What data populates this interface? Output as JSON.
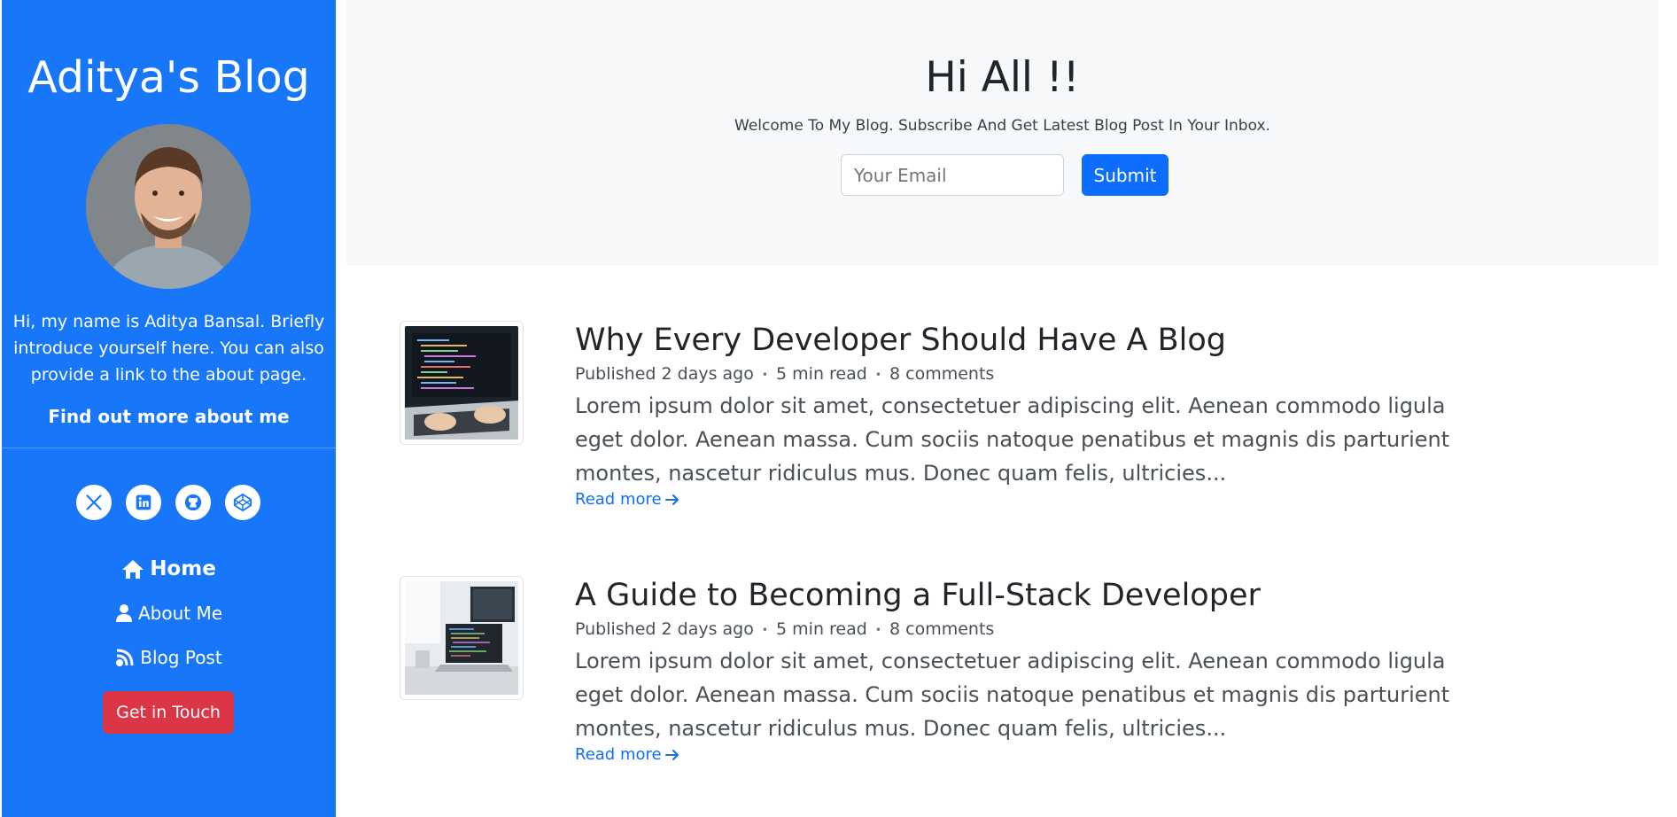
{
  "sidebar": {
    "blog_title": "Aditya's Blog",
    "bio": "Hi, my name is Aditya Bansal. Briefly introduce yourself here. You can also provide a link to the about page.",
    "about_link": "Find out more about me",
    "socials": [
      {
        "name": "x-icon"
      },
      {
        "name": "linkedin-icon"
      },
      {
        "name": "github-icon"
      },
      {
        "name": "codepen-icon"
      }
    ],
    "nav": {
      "home": "Home",
      "about": "About Me",
      "blog": "Blog Post"
    },
    "cta": "Get in Touch",
    "colors": {
      "background": "#1877f9",
      "cta": "#dc3545"
    }
  },
  "hero": {
    "title": "Hi All !!",
    "subtitle": "Welcome To My Blog. Subscribe And Get Latest Blog Post In Your Inbox.",
    "email_placeholder": "Your Email",
    "submit_label": "Submit"
  },
  "posts": [
    {
      "title": "Why Every Developer Should Have A Blog",
      "published": "Published 2 days ago",
      "read_time": "5 min read",
      "comments": "8 comments",
      "excerpt": "Lorem ipsum dolor sit amet, consectetuer adipiscing elit. Aenean commodo ligula eget dolor. Aenean massa. Cum sociis natoque penatibus et magnis dis parturient montes, nascetur ridiculus mus. Donec quam felis, ultricies...",
      "read_more": "Read more"
    },
    {
      "title": "A Guide to Becoming a Full-Stack Developer",
      "published": "Published 2 days ago",
      "read_time": "5 min read",
      "comments": "8 comments",
      "excerpt": "Lorem ipsum dolor sit amet, consectetuer adipiscing elit. Aenean commodo ligula eget dolor. Aenean massa. Cum sociis natoque penatibus et magnis dis parturient montes, nascetur ridiculus mus. Donec quam felis, ultricies...",
      "read_more": "Read more"
    }
  ]
}
